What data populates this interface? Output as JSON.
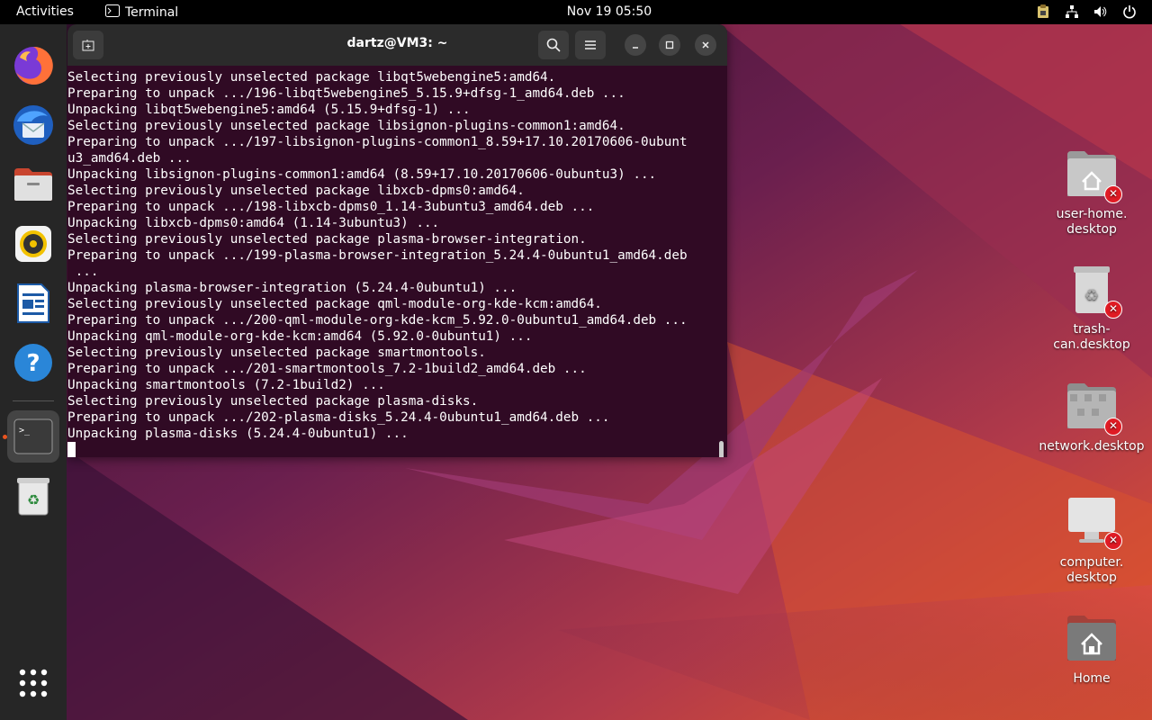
{
  "topbar": {
    "activities": "Activities",
    "app_name": "Terminal",
    "clock": "Nov 19  05:50"
  },
  "dock": {
    "items": [
      {
        "name": "firefox"
      },
      {
        "name": "thunderbird"
      },
      {
        "name": "files"
      },
      {
        "name": "rhythmbox"
      },
      {
        "name": "libreoffice-writer"
      },
      {
        "name": "help"
      },
      {
        "name": "terminal",
        "active": true
      },
      {
        "name": "trash"
      }
    ]
  },
  "terminal": {
    "title": "dartz@VM3: ~",
    "lines": [
      "Selecting previously unselected package libqt5webengine5:amd64.",
      "Preparing to unpack .../196-libqt5webengine5_5.15.9+dfsg-1_amd64.deb ...",
      "Unpacking libqt5webengine5:amd64 (5.15.9+dfsg-1) ...",
      "Selecting previously unselected package libsignon-plugins-common1:amd64.",
      "Preparing to unpack .../197-libsignon-plugins-common1_8.59+17.10.20170606-0ubunt",
      "u3_amd64.deb ...",
      "Unpacking libsignon-plugins-common1:amd64 (8.59+17.10.20170606-0ubuntu3) ...",
      "Selecting previously unselected package libxcb-dpms0:amd64.",
      "Preparing to unpack .../198-libxcb-dpms0_1.14-3ubuntu3_amd64.deb ...",
      "Unpacking libxcb-dpms0:amd64 (1.14-3ubuntu3) ...",
      "Selecting previously unselected package plasma-browser-integration.",
      "Preparing to unpack .../199-plasma-browser-integration_5.24.4-0ubuntu1_amd64.deb",
      " ...",
      "Unpacking plasma-browser-integration (5.24.4-0ubuntu1) ...",
      "Selecting previously unselected package qml-module-org-kde-kcm:amd64.",
      "Preparing to unpack .../200-qml-module-org-kde-kcm_5.92.0-0ubuntu1_amd64.deb ...",
      "Unpacking qml-module-org-kde-kcm:amd64 (5.92.0-0ubuntu1) ...",
      "Selecting previously unselected package smartmontools.",
      "Preparing to unpack .../201-smartmontools_7.2-1build2_amd64.deb ...",
      "Unpacking smartmontools (7.2-1build2) ...",
      "Selecting previously unselected package plasma-disks.",
      "Preparing to unpack .../202-plasma-disks_5.24.4-0ubuntu1_amd64.deb ...",
      "Unpacking plasma-disks (5.24.4-0ubuntu1) ..."
    ]
  },
  "desktop": {
    "icons": [
      {
        "label_1": "user-home.",
        "label_2": "desktop"
      },
      {
        "label_1": "trash-can.desktop",
        "label_2": ""
      },
      {
        "label_1": "network.desktop",
        "label_2": ""
      },
      {
        "label_1": "computer.",
        "label_2": "desktop"
      },
      {
        "label_1": "Home",
        "label_2": ""
      }
    ]
  },
  "colors": {
    "terminal_bg": "#300a24",
    "accent": "#e95420",
    "titlebar": "#2b2b2b"
  }
}
